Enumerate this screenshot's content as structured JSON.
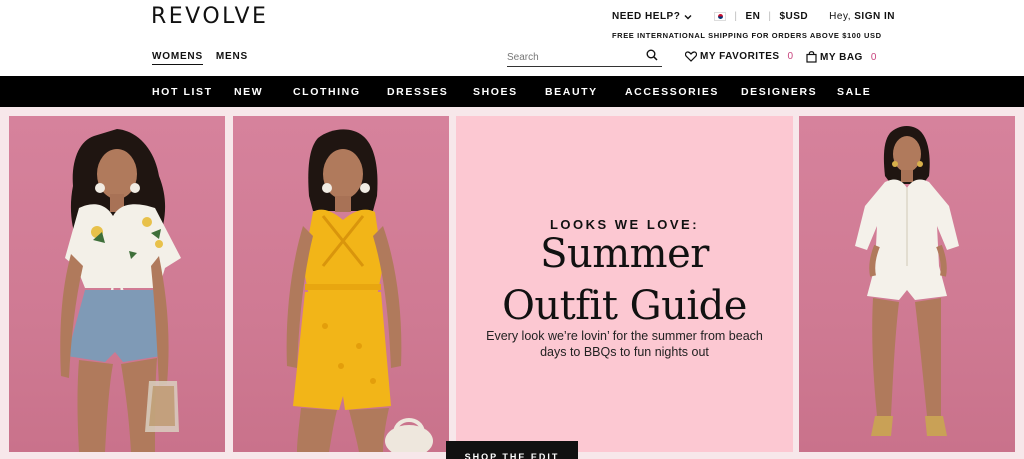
{
  "header": {
    "logo": "REVOLVE",
    "gender_tabs": [
      {
        "label": "WOMENS",
        "active": true
      },
      {
        "label": "MENS",
        "active": false
      }
    ],
    "help_label": "NEED HELP?",
    "language": "EN",
    "currency": "$USD",
    "greeting": "Hey,",
    "sign_in": "SIGN IN",
    "shipping_notice": "FREE INTERNATIONAL SHIPPING FOR ORDERS ABOVE $100 USD",
    "search_placeholder": "Search",
    "favorites_label": "MY FAVORITES",
    "favorites_count": "0",
    "bag_label": "MY BAG",
    "bag_count": "0"
  },
  "nav": {
    "items": [
      "HOT LIST",
      "NEW",
      "CLOTHING",
      "DRESSES",
      "SHOES",
      "BEAUTY",
      "ACCESSORIES",
      "DESIGNERS",
      "SALE"
    ]
  },
  "hero": {
    "eyebrow": "LOOKS WE LOVE:",
    "headline_line1": "Summer",
    "headline_line2": "Outfit Guide",
    "subtext": "Every look we’re lovin’ for the summer from beach days to BBQs to fun nights out",
    "cta": "SHOP THE EDIT",
    "photos": [
      {
        "name": "floral-top-denim-shorts-model"
      },
      {
        "name": "yellow-romper-model"
      },
      {
        "name": "white-romper-model"
      }
    ]
  },
  "colors": {
    "nav_bg": "#000000",
    "accent_pink": "#c8447e",
    "feature_bg": "#fcc8d2",
    "photo_bg": "#d6829c",
    "yellow_romper": "#f2b518"
  }
}
